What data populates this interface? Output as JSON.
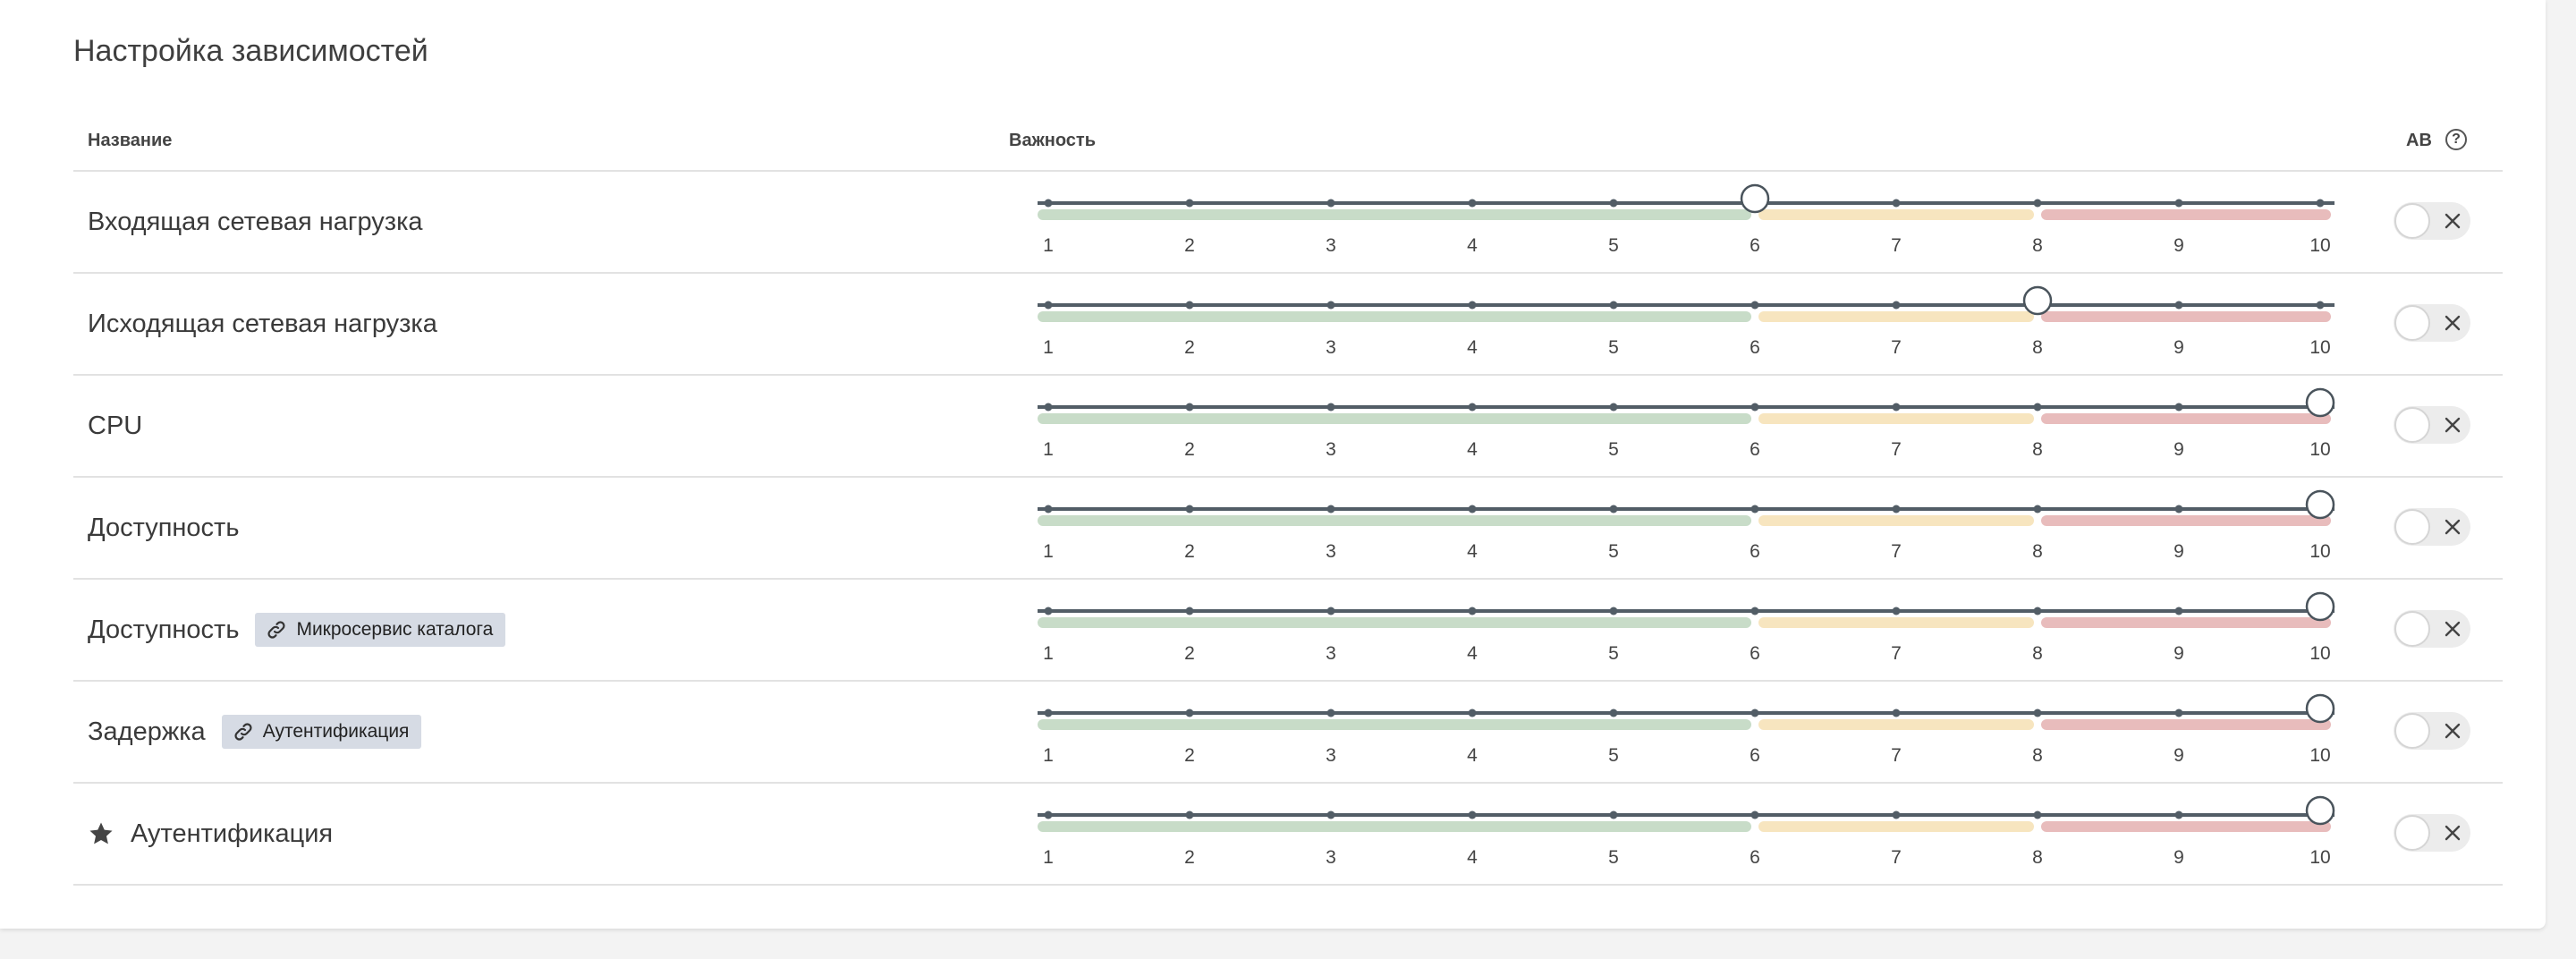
{
  "panel": {
    "title": "Настройка зависимостей"
  },
  "table": {
    "headers": {
      "name": "Название",
      "importance": "Важность",
      "ab": "AB"
    },
    "help_icon_glyph": "?",
    "scale": {
      "min": 1,
      "max": 10,
      "ticks": [
        "1",
        "2",
        "3",
        "4",
        "5",
        "6",
        "7",
        "8",
        "9",
        "10"
      ]
    },
    "zones": [
      {
        "from": 1,
        "to": 6,
        "color": "#c8dcc8"
      },
      {
        "from": 6,
        "to": 8,
        "color": "#f7e5bf"
      },
      {
        "from": 8,
        "to": 10,
        "color": "#e8bcbc"
      }
    ],
    "rows": [
      {
        "label": "Входящая сетевая нагрузка",
        "tag": null,
        "star": false,
        "value": 6,
        "ab_enabled": false
      },
      {
        "label": "Исходящая сетевая нагрузка",
        "tag": null,
        "star": false,
        "value": 8,
        "ab_enabled": false
      },
      {
        "label": "CPU",
        "tag": null,
        "star": false,
        "value": 10,
        "ab_enabled": false
      },
      {
        "label": "Доступность",
        "tag": null,
        "star": false,
        "value": 10,
        "ab_enabled": false
      },
      {
        "label": "Доступность",
        "tag": "Микросервис каталога",
        "star": false,
        "value": 10,
        "ab_enabled": false
      },
      {
        "label": "Задержка",
        "tag": "Аутентификация",
        "star": false,
        "value": 10,
        "ab_enabled": false
      },
      {
        "label": "Аутентификация",
        "tag": null,
        "star": true,
        "value": 10,
        "ab_enabled": false
      }
    ]
  },
  "icons": {
    "help": "help-circle-icon",
    "link": "link-icon",
    "star": "star-icon",
    "toggle_off": "close-icon"
  }
}
